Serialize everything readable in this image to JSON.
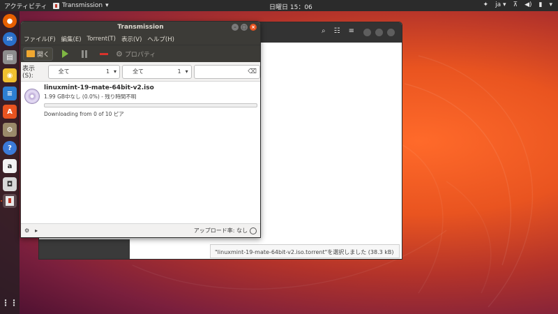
{
  "topbar": {
    "activities": "アクティビティ",
    "app_name": "Transmission",
    "clock": "日曜日 15：06",
    "input_method": "ja"
  },
  "dock": {
    "icons": [
      "firefox-icon",
      "thunderbird-icon",
      "files-icon",
      "rhythmbox-icon",
      "writer-icon",
      "software-icon",
      "settings-icon",
      "help-icon",
      "amazon-icon",
      "screenshot-icon",
      "transmission-icon"
    ],
    "apps_grid_icon": "apps-grid-icon"
  },
  "filechooser": {
    "status_text": "\"linuxmint-19-mate-64bit-v2.iso.torrent\"を選択しました (38.3 kB)"
  },
  "window": {
    "title": "Transmission",
    "menu": [
      "ファイル(F)",
      "編集(E)",
      "Torrent(T)",
      "表示(V)",
      "ヘルプ(H)"
    ],
    "toolbar": {
      "open_label": "開く",
      "properties_label": "プロパティ"
    },
    "filter": {
      "show_label": "表示(S):",
      "activity_value": "全て",
      "activity_count": "1",
      "tracker_value": "全て",
      "tracker_count": "1",
      "search_value": ""
    },
    "torrent": {
      "name": "linuxmint-19-mate-64bit-v2.iso",
      "progress_text": "1.99 GB中なし (0.0%) - 残り時間不明",
      "progress_fraction": 0.0,
      "status": "Downloading from 0 of 10 ピア"
    },
    "statusbar": {
      "ratio_text": "アップロード率: なし"
    }
  }
}
